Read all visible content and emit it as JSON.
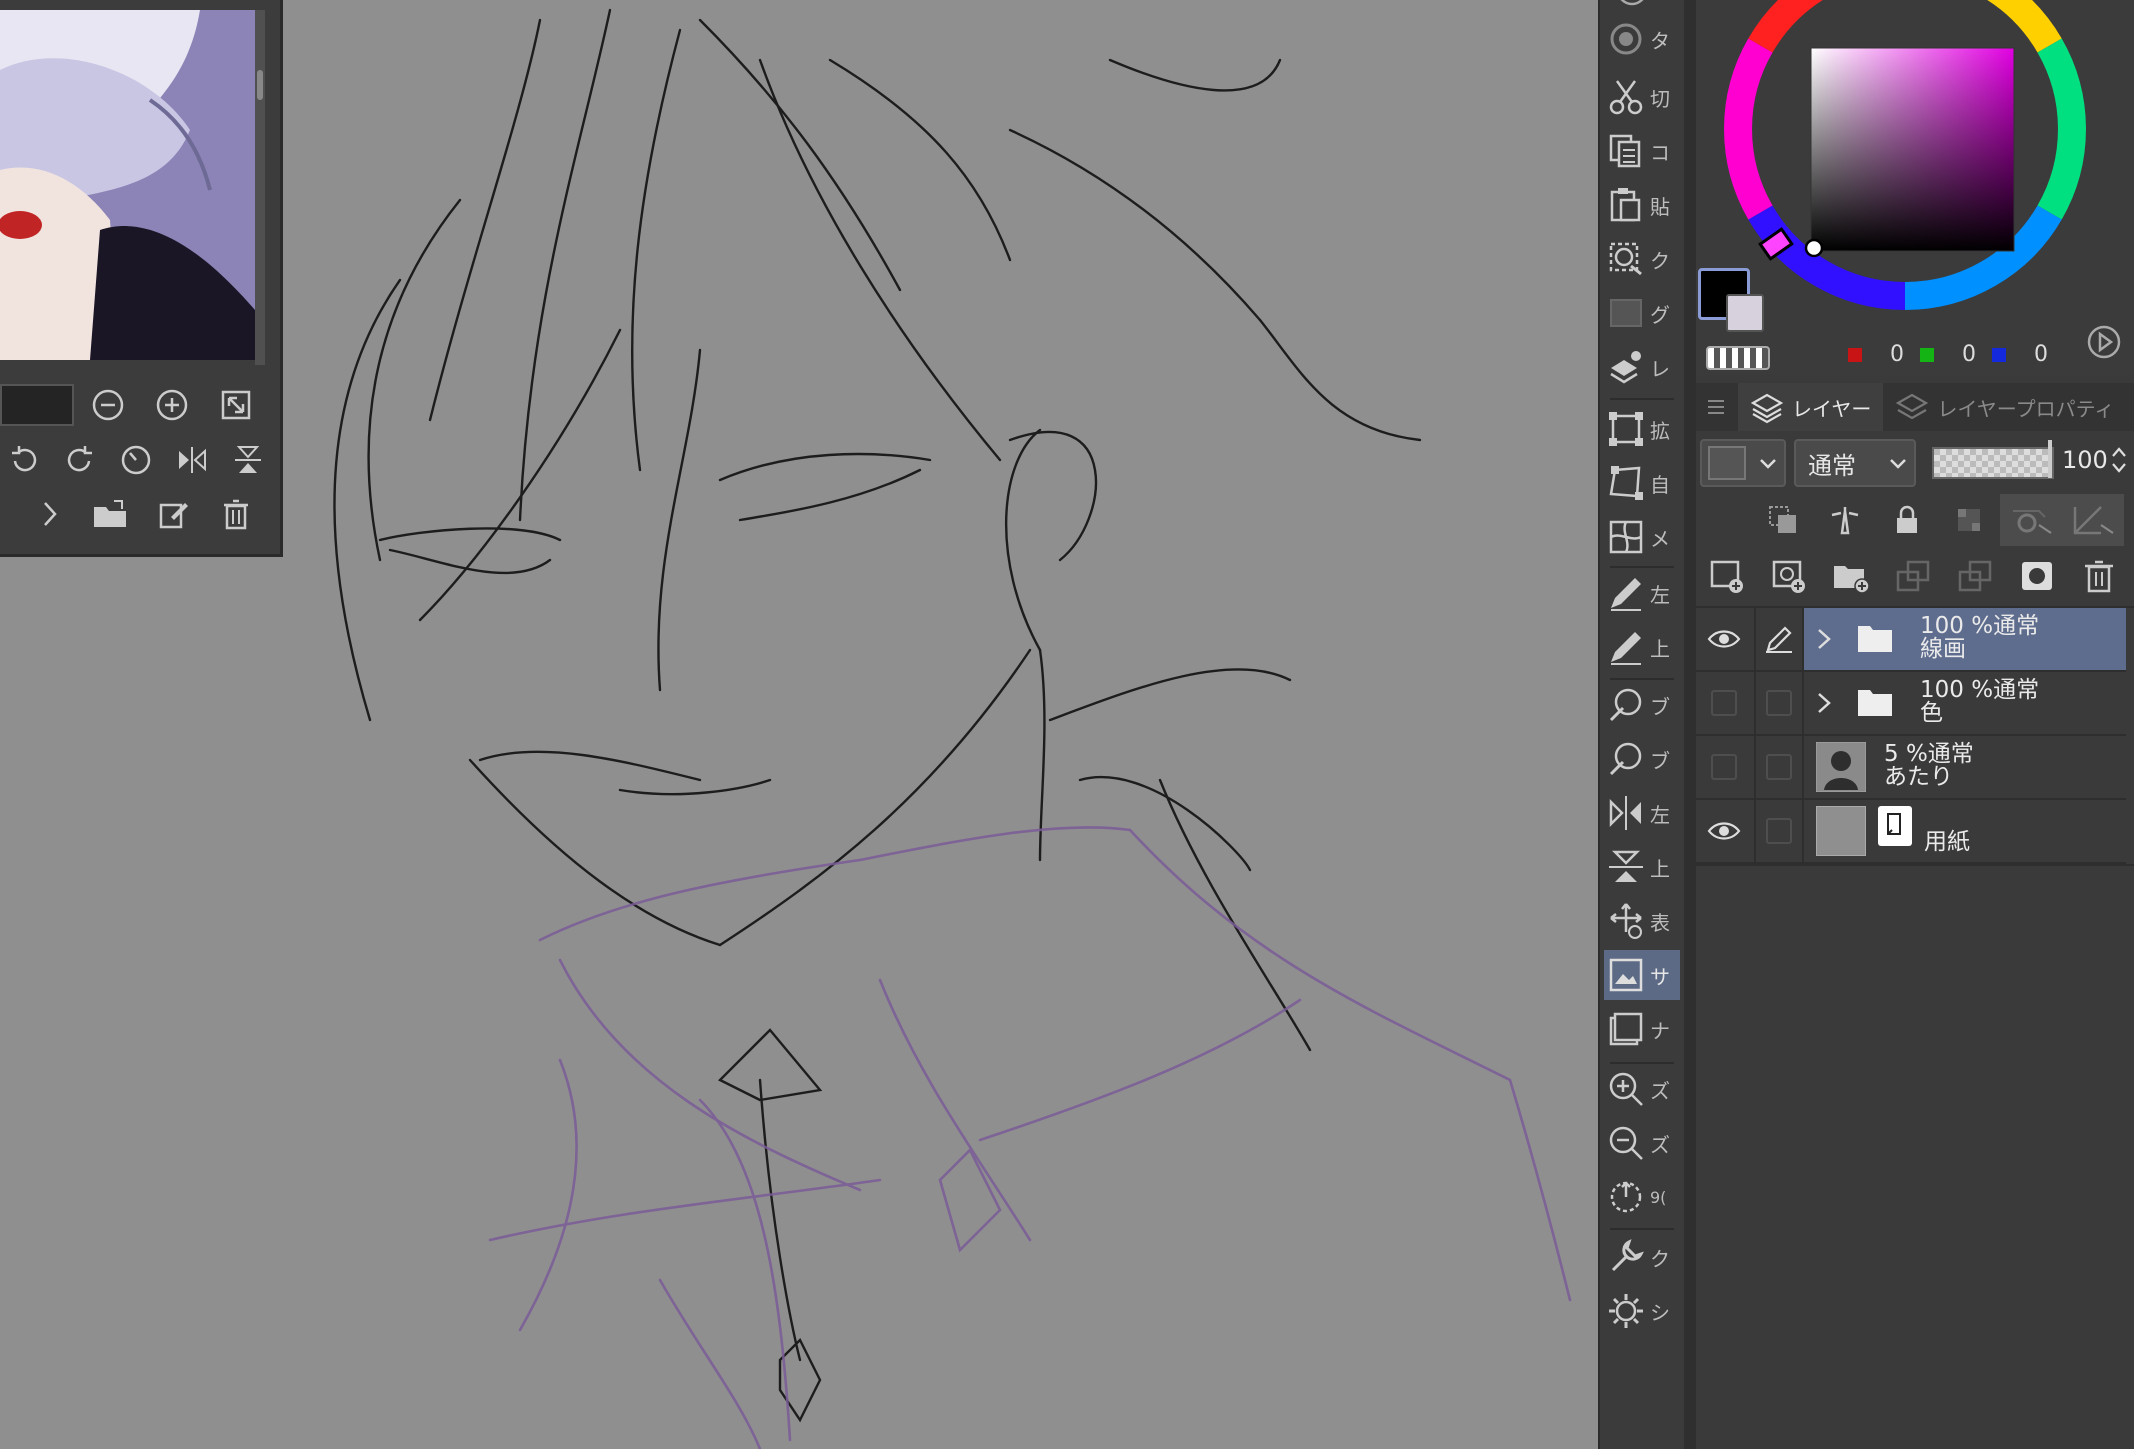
{
  "toolbar": {
    "items": [
      {
        "label": "タ",
        "icon": "timelapse-icon"
      },
      {
        "label": "切",
        "icon": "cut-icon"
      },
      {
        "label": "コ",
        "icon": "copy-icon"
      },
      {
        "label": "貼",
        "icon": "paste-icon"
      },
      {
        "label": "ク",
        "icon": "clear-icon"
      },
      {
        "label": "グ",
        "icon": "fill-icon"
      },
      {
        "label": "レ",
        "icon": "layer-from-selection-icon"
      },
      {
        "label": "拡",
        "icon": "scale-icon"
      },
      {
        "label": "自",
        "icon": "free-transform-icon"
      },
      {
        "label": "メ",
        "icon": "mesh-transform-icon"
      },
      {
        "label": "左",
        "icon": "pen-left-icon"
      },
      {
        "label": "上",
        "icon": "pen-up-icon"
      },
      {
        "label": "ブ",
        "icon": "brush-size-up-icon"
      },
      {
        "label": "ブ",
        "icon": "brush-size-down-icon"
      },
      {
        "label": "左",
        "icon": "flip-horizontal-icon"
      },
      {
        "label": "上",
        "icon": "flip-vertical-icon"
      },
      {
        "label": "表",
        "icon": "move-view-icon"
      },
      {
        "label": "サ",
        "icon": "sub-view-icon"
      },
      {
        "label": "ナ",
        "icon": "navigator-icon"
      },
      {
        "label": "ズ",
        "icon": "zoom-in-icon"
      },
      {
        "label": "ズ",
        "icon": "zoom-out-icon"
      },
      {
        "label": "9(",
        "icon": "rotate-90-icon"
      },
      {
        "label": "ク",
        "icon": "quick-access-icon"
      },
      {
        "label": "シ",
        "icon": "settings-icon"
      }
    ]
  },
  "color": {
    "main": "#000000",
    "sub": "#d7d1de",
    "r": "0",
    "g": "0",
    "b": "0",
    "hue_color": "#e100e1"
  },
  "layer_panel": {
    "tab_layer": "レイヤー",
    "tab_props": "レイヤープロパティ",
    "blend_mode": "通常",
    "opacity": "100"
  },
  "layers": [
    {
      "pct": "100 %通常",
      "name": "線画",
      "visible": true,
      "editing": true,
      "type": "folder"
    },
    {
      "pct": "100 %通常",
      "name": "色",
      "visible": false,
      "editing": false,
      "type": "folder"
    },
    {
      "pct": "5 %通常",
      "name": "あたり",
      "visible": false,
      "editing": false,
      "type": "raster"
    },
    {
      "pct": "",
      "name": "用紙",
      "visible": true,
      "editing": false,
      "type": "paper"
    }
  ]
}
